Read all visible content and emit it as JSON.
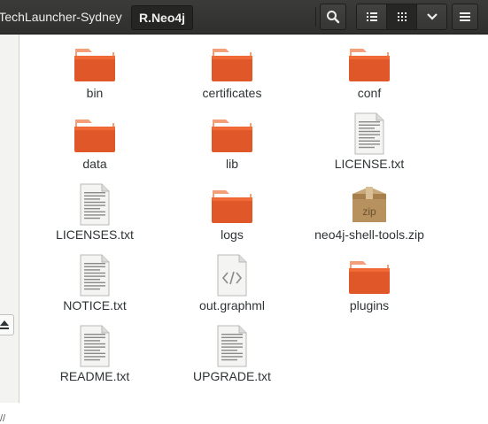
{
  "header": {
    "breadcrumbs": [
      {
        "label": "TechLauncher-Sydney"
      },
      {
        "label": "R.Neo4j"
      }
    ]
  },
  "files": [
    {
      "name": "bin",
      "kind": "folder"
    },
    {
      "name": "certificates",
      "kind": "folder"
    },
    {
      "name": "conf",
      "kind": "folder"
    },
    {
      "name": "data",
      "kind": "folder"
    },
    {
      "name": "lib",
      "kind": "folder"
    },
    {
      "name": "LICENSE.txt",
      "kind": "text"
    },
    {
      "name": "LICENSES.txt",
      "kind": "text"
    },
    {
      "name": "logs",
      "kind": "folder"
    },
    {
      "name": "neo4j-shell-tools.zip",
      "kind": "zip",
      "badge": "zip"
    },
    {
      "name": "NOTICE.txt",
      "kind": "text"
    },
    {
      "name": "out.graphml",
      "kind": "markup"
    },
    {
      "name": "plugins",
      "kind": "folder"
    },
    {
      "name": "README.txt",
      "kind": "text"
    },
    {
      "name": "UPGRADE.txt",
      "kind": "text"
    }
  ],
  "sidebar": {
    "bottom_text": "//"
  },
  "colors": {
    "headerbar": "#353533",
    "folder_front": "#e0582a",
    "folder_back": "#f3a07a",
    "text_color": "#2e3436"
  }
}
